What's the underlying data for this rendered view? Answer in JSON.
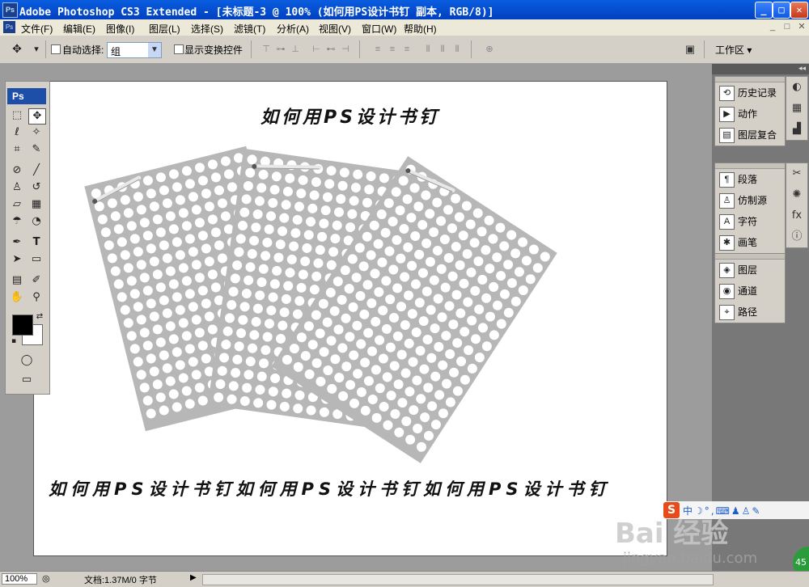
{
  "window": {
    "title": "Adobe Photoshop CS3 Extended - [未标题-3 @ 100% (如何用PS设计书钉 副本, RGB/8)]",
    "app_icon": "Ps",
    "minimize": "_",
    "maximize": "□",
    "close": "✕"
  },
  "menu": {
    "items": [
      "文件(F)",
      "编辑(E)",
      "图像(I)",
      "图层(L)",
      "选择(S)",
      "滤镜(T)",
      "分析(A)",
      "视图(V)",
      "窗口(W)",
      "帮助(H)"
    ],
    "doc_controls": [
      "_",
      "□",
      "✕"
    ]
  },
  "options": {
    "auto_select_label": "自动选择:",
    "auto_select_value": "组",
    "show_transform_label": "显示变换控件",
    "workspace_label": "工作区 ▾"
  },
  "toolbox": {
    "logo": "Ps",
    "icons": [
      "marquee-icon",
      "move-icon",
      "lasso-icon",
      "magic-wand-icon",
      "crop-icon",
      "eyedropper-icon",
      "healing-icon",
      "brush-icon",
      "stamp-icon",
      "history-brush-icon",
      "eraser-icon",
      "gradient-icon",
      "blur-icon",
      "dodge-icon",
      "pen-icon",
      "type-icon",
      "path-select-icon",
      "shape-icon",
      "notes-icon",
      "eyedropper2-icon",
      "hand-icon",
      "zoom-icon"
    ]
  },
  "document": {
    "headline": "如何用PS设计书钉",
    "footline": "如何用PS设计书钉如何用PS设计书钉如何用PS设计书钉"
  },
  "panels": {
    "group1": [
      "历史记录",
      "动作",
      "图层复合"
    ],
    "group2": [
      "段落",
      "仿制源",
      "字符",
      "画笔"
    ],
    "group3": [
      "图层",
      "通道",
      "路径"
    ]
  },
  "status": {
    "zoom": "100%",
    "doc_info": "文档:1.37M/0 字节"
  },
  "watermark": {
    "brand": "Bai 经验",
    "url": "jingyan.baidu.com",
    "ime_logo": "S",
    "badge": "45"
  }
}
